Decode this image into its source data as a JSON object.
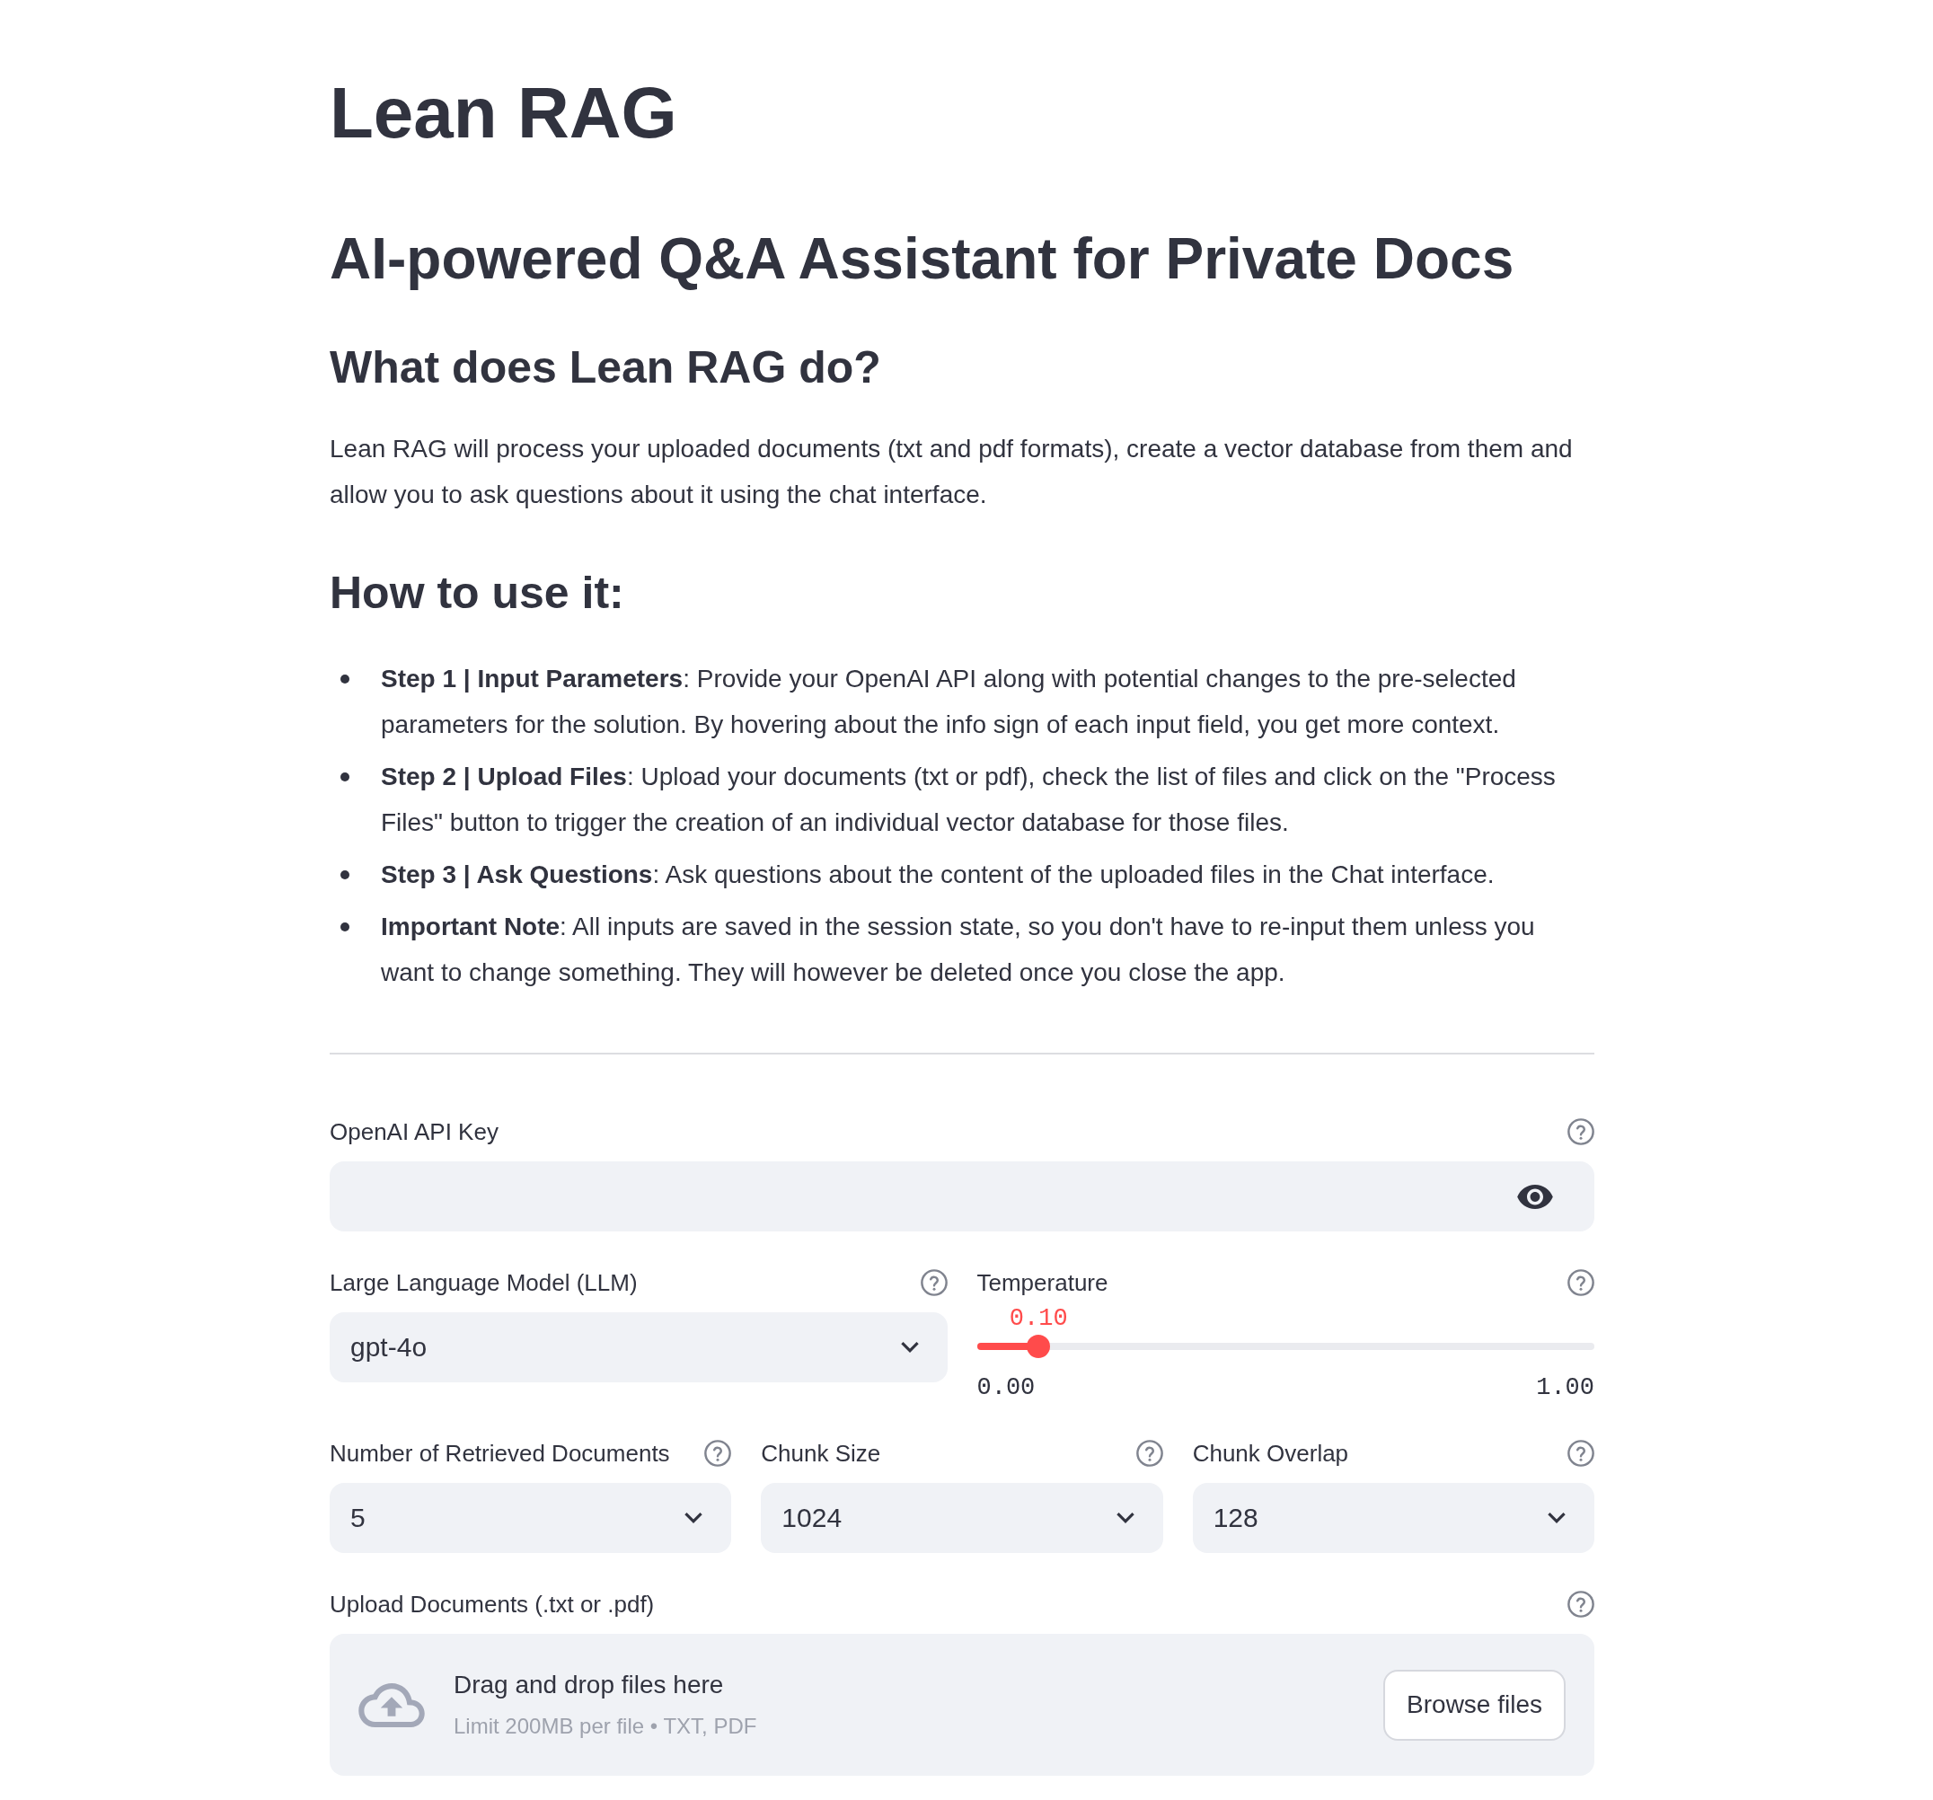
{
  "title": "Lean RAG",
  "subtitle": "AI-powered Q&A Assistant for Private Docs",
  "about": {
    "heading": "What does Lean RAG do?",
    "text": "Lean RAG will process your uploaded documents (txt and pdf formats), create a vector database from them and allow you to ask questions about it using the chat interface."
  },
  "how_to": {
    "heading": "How to use it:",
    "steps": [
      "**Step 1 | Input Parameters**: Provide your OpenAI API along with potential changes to the pre-selected parameters for the solution. By hovering about the info sign of each input field, you get more context.",
      "**Step 2 | Upload Files**: Upload your documents (txt or pdf), check the list of files and click on the \"Process Files\" button to trigger the creation of an individual vector database for those files.",
      "**Step 3 | Ask Questions**: Ask questions about the content of the uploaded files in the Chat interface.",
      "**Important Note**: All inputs are saved in the session state, so you don't have to re-input them unless you want to change something. They will however be deleted once you close the app."
    ]
  },
  "form": {
    "rows": [
      {
        "fields": [
          {
            "kind": "password",
            "label": "OpenAI API Key"
          }
        ]
      },
      {
        "fields": [
          {
            "kind": "select",
            "label": "Large Language Model (LLM)",
            "value": "gpt-4o"
          },
          {
            "kind": "slider",
            "label": "Temperature",
            "value": "0.10",
            "level": 0.1,
            "min": "0.00",
            "max": "1.00"
          }
        ]
      },
      {
        "fields": [
          {
            "kind": "select",
            "label": "Number of Retrieved Documents",
            "value": "5"
          },
          {
            "kind": "select",
            "label": "Chunk Size",
            "value": "1024"
          },
          {
            "kind": "select",
            "label": "Chunk Overlap",
            "value": "128"
          }
        ]
      },
      {
        "fields": [
          {
            "kind": "uploader",
            "label": "Upload Documents (.txt or .pdf)",
            "drop_text": "Drag and drop files here",
            "limit_text": "Limit 200MB per file • TXT, PDF",
            "button": "Browse files"
          }
        ]
      }
    ]
  }
}
